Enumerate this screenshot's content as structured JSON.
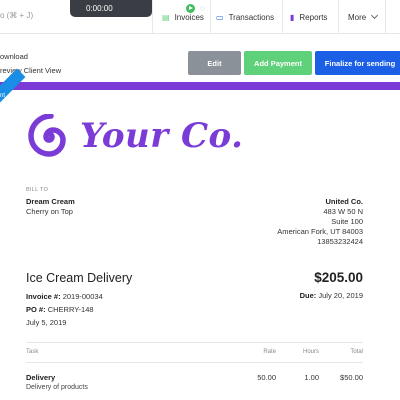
{
  "topnav": {
    "search_hint": "o (⌘ + J)",
    "timer": "0:00:00",
    "items": [
      {
        "label": "Invoices",
        "icon": "invoice-icon"
      },
      {
        "label": "Transactions",
        "icon": "transactions-icon"
      },
      {
        "label": "Reports",
        "icon": "reports-icon"
      },
      {
        "label": "More",
        "icon": "chevron-down-icon"
      }
    ]
  },
  "actions": {
    "download": "ownload",
    "preview": "review Client View",
    "edit": "Edit",
    "add_payment": "Add Payment",
    "finalize": "Finalize for sending"
  },
  "ribbon": "nt",
  "logo": {
    "text": "Your Co.",
    "color": "#7b3bd6"
  },
  "bill_to": {
    "label": "BILL TO",
    "name": "Dream Cream",
    "sub": "Cherry on Top"
  },
  "from": {
    "name": "United Co.",
    "lines": [
      "483 W 50 N",
      "Suite 100",
      "American Fork, UT 84003",
      "13853232424"
    ]
  },
  "invoice": {
    "title": "Ice Cream Delivery",
    "number_label": "Invoice #:",
    "number": "2019-00034",
    "po_label": "PO #:",
    "po": "CHERRY-148",
    "date": "July 5, 2019",
    "total": "$205.00",
    "due_label": "Due:",
    "due": "July 20, 2019"
  },
  "table": {
    "headers": {
      "task": "Task",
      "rate": "Rate",
      "hours": "Hours",
      "total": "Total"
    },
    "rows": [
      {
        "task": "Delivery",
        "description": "Delivery of products",
        "rate": "50.00",
        "hours": "1.00",
        "total": "$50.00"
      }
    ]
  },
  "colors": {
    "accent": "#7b3bd6",
    "edit": "#8a9199",
    "add_payment": "#5fd17a",
    "finalize": "#1a5fe6",
    "ribbon": "#1a8ee6"
  }
}
